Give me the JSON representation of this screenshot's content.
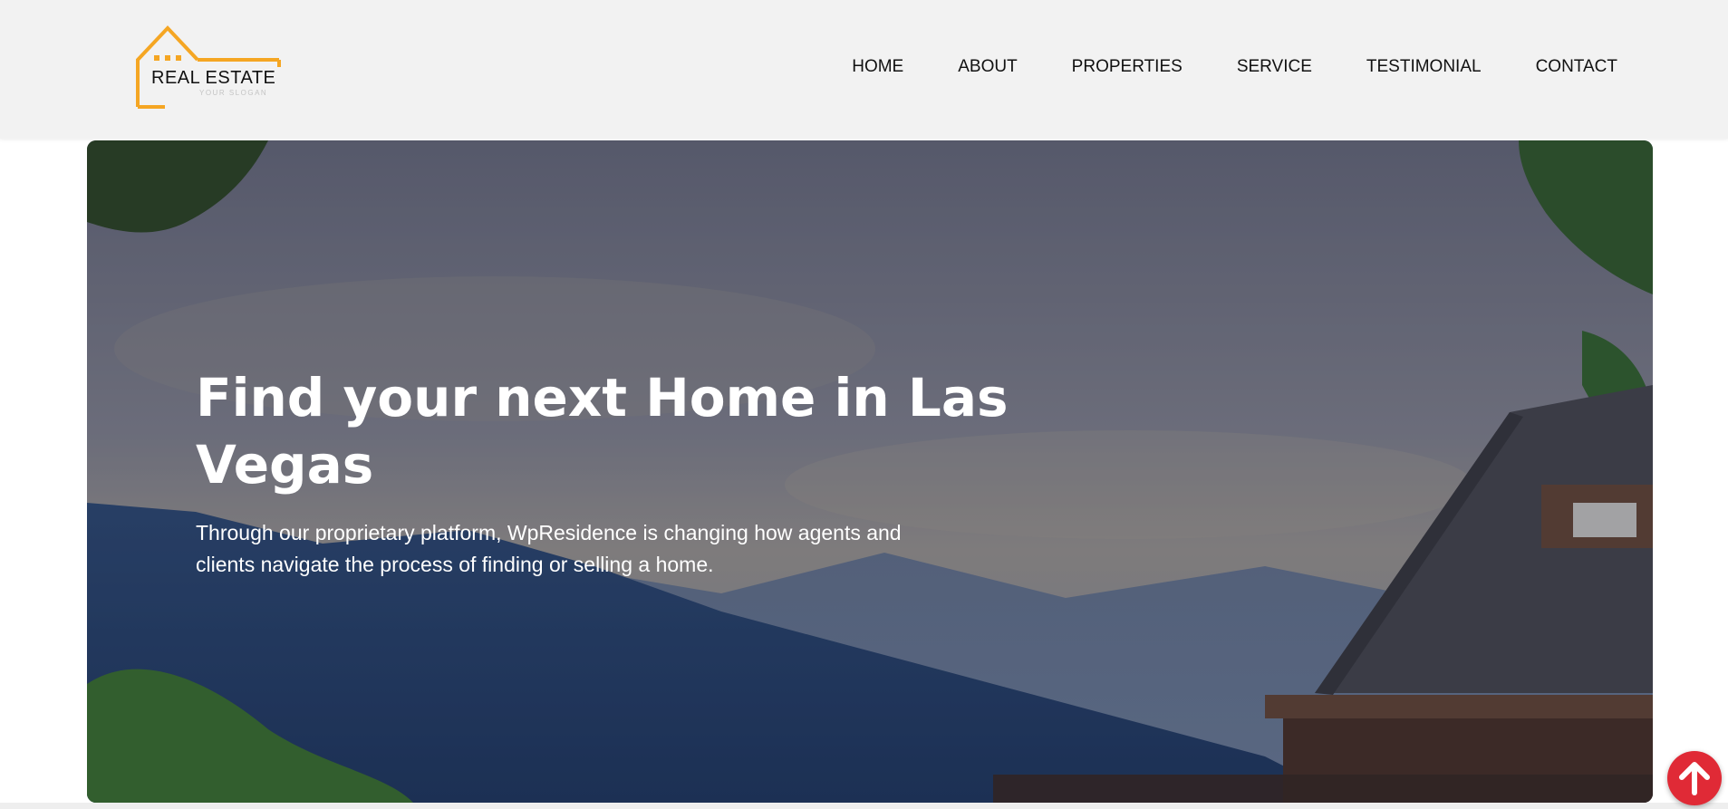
{
  "brand": {
    "title": "REAL ESTATE",
    "slogan": "YOUR SLOGAN",
    "accent_color": "#f5a623"
  },
  "nav": {
    "items": [
      {
        "label": "HOME"
      },
      {
        "label": "ABOUT"
      },
      {
        "label": "PROPERTIES"
      },
      {
        "label": "SERVICE"
      },
      {
        "label": "TESTIMONIAL"
      },
      {
        "label": "CONTACT"
      }
    ]
  },
  "hero": {
    "title": "Find your next Home in Las Vegas",
    "text": "Through our proprietary platform, WpResidence is changing how agents and clients navigate the process of finding or selling a home.",
    "image": "mountain landscape with house roof"
  },
  "scroll_top": {
    "icon": "arrow-up-icon",
    "color": "#e02a36"
  }
}
